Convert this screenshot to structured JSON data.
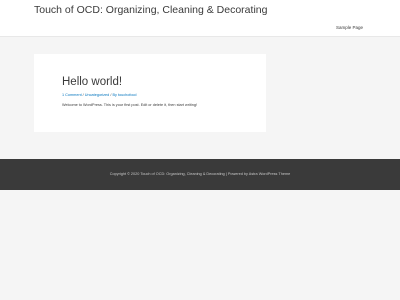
{
  "header": {
    "site_title": "Touch of OCD: Organizing, Cleaning & Decorating",
    "nav_items": [
      "Sample Page"
    ]
  },
  "post": {
    "title": "Hello world!",
    "meta": {
      "comments": "1 Comment",
      "sep1": " / ",
      "category": "Uncategorized",
      "sep2": " / ",
      "by": "By ",
      "author": "touchofocd"
    },
    "excerpt": "Welcome to WordPress. This is your first post. Edit or delete it, then start writing!"
  },
  "footer": {
    "copyright": "Copyright © 2020 Touch of OCD: Organizing, Cleaning & Decorating",
    "separator": " | ",
    "powered_by": "Powered by ",
    "theme_link": "Astra WordPress Theme"
  },
  "colors": {
    "background": "#f5f5f5",
    "header_bg": "#ffffff",
    "footer_bg": "#3a3a3a",
    "link": "#0274be",
    "text": "#3a3a3a"
  }
}
